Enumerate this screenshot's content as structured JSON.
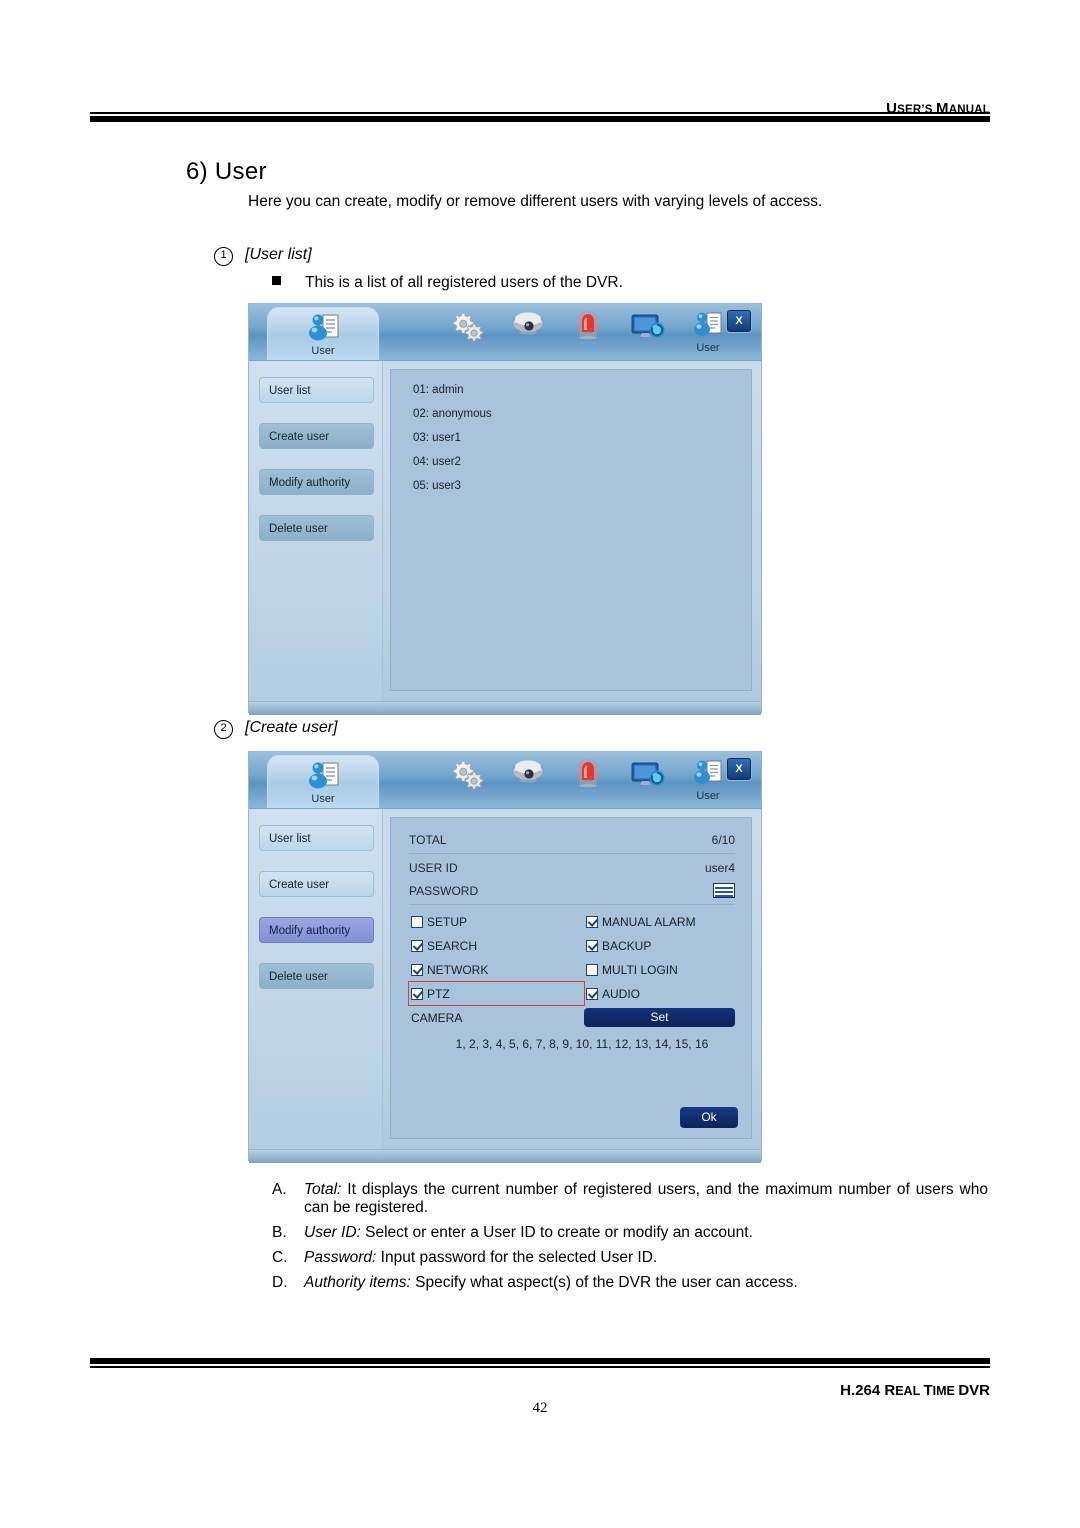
{
  "page": {
    "header_label_caps": "U",
    "header_label_rest": "SER’S ",
    "header_label_m": "M",
    "header_label_manual": "ANUAL",
    "header_text": "USER'S MANUAL",
    "footer_text": "H.264 REAL TIME DVR",
    "footer_h264": "H.264 ",
    "footer_r": "R",
    "footer_eal": "EAL ",
    "footer_t": "T",
    "footer_ime": "IME ",
    "footer_dvr": "DVR",
    "page_number": "42"
  },
  "section": {
    "title": "6) User",
    "intro": "Here you can create, modify or remove different users with varying levels of access.",
    "item1_num": "1",
    "item1_label": "[User list]",
    "bullet1": "This is a list of all registered users of the DVR.",
    "item2_num": "2",
    "item2_label": "[Create user]"
  },
  "dialog1": {
    "tab_label": "User",
    "toolbar": [
      {
        "name": "system-gears-icon",
        "caption": ""
      },
      {
        "name": "camera-dome-icon",
        "caption": ""
      },
      {
        "name": "alarm-light-icon",
        "caption": ""
      },
      {
        "name": "network-monitor-icon",
        "caption": ""
      },
      {
        "name": "user-icon",
        "caption": "User"
      }
    ],
    "close_label": "X",
    "sidebar": [
      {
        "label": "User list",
        "state": "selected-light"
      },
      {
        "label": "Create user",
        "state": "normal"
      },
      {
        "label": "Modify authority",
        "state": "normal"
      },
      {
        "label": "Delete user",
        "state": "normal"
      }
    ],
    "user_list": [
      "01: admin",
      "02: anonymous",
      "03: user1",
      "04: user2",
      "05: user3"
    ]
  },
  "dialog2": {
    "tab_label": "User",
    "toolbar": [
      {
        "name": "system-gears-icon",
        "caption": ""
      },
      {
        "name": "camera-dome-icon",
        "caption": ""
      },
      {
        "name": "alarm-light-icon",
        "caption": ""
      },
      {
        "name": "network-monitor-icon",
        "caption": ""
      },
      {
        "name": "user-icon",
        "caption": "User"
      }
    ],
    "close_label": "X",
    "sidebar": [
      {
        "label": "User list",
        "state": "normal"
      },
      {
        "label": "Create user",
        "state": "normal"
      },
      {
        "label": "Modify authority",
        "state": "selected-blue"
      },
      {
        "label": "Delete user",
        "state": "normal"
      }
    ],
    "form": {
      "total_label": "TOTAL",
      "total_value": "6/10",
      "userid_label": "USER ID",
      "userid_value": "user4",
      "password_label": "PASSWORD",
      "password_icon": "keyboard-icon",
      "camera_label": "CAMERA",
      "set_label": "Set",
      "camera_list": "1, 2, 3, 4, 5, 6, 7, 8, 9, 10, 11, 12, 13, 14, 15, 16",
      "ok_label": "Ok"
    },
    "authority": [
      {
        "label": "SETUP",
        "checked": false,
        "highlight": false
      },
      {
        "label": "MANUAL ALARM",
        "checked": true,
        "highlight": false
      },
      {
        "label": "SEARCH",
        "checked": true,
        "highlight": false
      },
      {
        "label": "BACKUP",
        "checked": true,
        "highlight": false
      },
      {
        "label": "NETWORK",
        "checked": true,
        "highlight": false
      },
      {
        "label": "MULTI LOGIN",
        "checked": false,
        "highlight": false
      },
      {
        "label": "PTZ",
        "checked": true,
        "highlight": true
      },
      {
        "label": "AUDIO",
        "checked": true,
        "highlight": false
      }
    ]
  },
  "notes": [
    {
      "label": "A.",
      "em": "Total:",
      "text": " It displays the current number of registered users, and the maximum number of users who can be registered."
    },
    {
      "label": "B.",
      "em": "User ID:",
      "text": " Select or enter a User ID to create or modify an account."
    },
    {
      "label": "C.",
      "em": "Password:",
      "text": " Input password for the selected User ID."
    },
    {
      "label": "D.",
      "em": "Authority items:",
      "text": " Specify what aspect(s) of the DVR the user can access."
    }
  ],
  "colors": {
    "accent_navy": "#0d2356",
    "highlight_red": "#e03a3a",
    "dialog_blue": "#b6cde2",
    "selected_blue": "#7f8fd4"
  }
}
